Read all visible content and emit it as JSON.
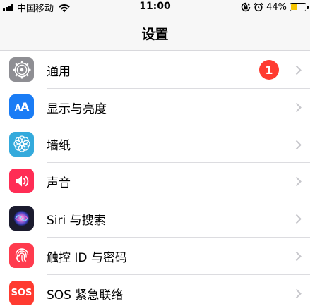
{
  "status_bar": {
    "carrier": "中国移动",
    "time": "11:00",
    "battery_percent": "44%",
    "battery_level": 0.44,
    "battery_color": "#f5c400"
  },
  "nav": {
    "title": "设置"
  },
  "settings": {
    "items": [
      {
        "label": "通用",
        "icon": "gear-icon",
        "badge": "1"
      },
      {
        "label": "显示与亮度",
        "icon": "text-size-icon",
        "icon_text_large": "A",
        "icon_text_small": "A"
      },
      {
        "label": "墙纸",
        "icon": "flower-icon"
      },
      {
        "label": "声音",
        "icon": "speaker-icon"
      },
      {
        "label": "Siri 与搜索",
        "icon": "siri-icon"
      },
      {
        "label": "触控 ID 与密码",
        "icon": "fingerprint-icon"
      },
      {
        "label": "SOS 紧急联络",
        "icon": "sos-icon",
        "icon_text": "SOS"
      }
    ]
  },
  "colors": {
    "badge": "#ff3b30",
    "general": "#8e8e93",
    "display": "#1a7cf5",
    "wallpaper": "#34aadc",
    "sound": "#ff2d55",
    "touchid": "#ff3b4e",
    "sos": "#ff3b30"
  }
}
